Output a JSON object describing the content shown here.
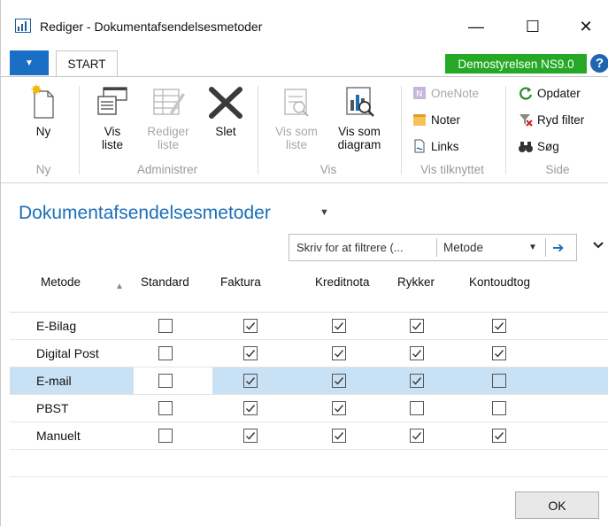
{
  "window": {
    "title": "Rediger - Dokumentafsendelsesmetoder",
    "minimize": "—",
    "maximize": "☐",
    "close": "✕"
  },
  "ribbon_tabs": {
    "active": "START",
    "company": "Demostyrelsen NS9.0",
    "help": "?"
  },
  "ribbon": {
    "new": "Ny",
    "view_list_1": "Vis",
    "view_list_2": "liste",
    "edit_list_1": "Rediger",
    "edit_list_2": "liste",
    "delete": "Slet",
    "view_as_list_1": "Vis som",
    "view_as_list_2": "liste",
    "view_as_chart_1": "Vis som",
    "view_as_chart_2": "diagram",
    "onenote": "OneNote",
    "notes": "Noter",
    "links": "Links",
    "refresh": "Opdater",
    "clear_filter": "Ryd filter",
    "search": "Søg",
    "groups": {
      "new": "Ny",
      "manage": "Administrer",
      "view": "Vis",
      "show_attached": "Vis tilknyttet",
      "page": "Side"
    }
  },
  "page": {
    "title": "Dokumentafsendelsesmetoder",
    "filter_placeholder": "Skriv for at filtrere (...",
    "filter_field": "Metode"
  },
  "columns": [
    "Metode",
    "Standard",
    "Faktura",
    "Kreditnota",
    "Rykker",
    "Kontoudtog"
  ],
  "rows": [
    {
      "name": "E-Bilag",
      "values": [
        false,
        true,
        true,
        true,
        true
      ]
    },
    {
      "name": "Digital Post",
      "values": [
        false,
        true,
        true,
        true,
        true
      ]
    },
    {
      "name": "E-mail",
      "values": [
        false,
        true,
        true,
        true,
        false
      ],
      "selected": true
    },
    {
      "name": "PBST",
      "values": [
        false,
        true,
        true,
        false,
        false
      ]
    },
    {
      "name": "Manuelt",
      "values": [
        false,
        true,
        true,
        true,
        true
      ]
    }
  ],
  "footer": {
    "ok": "OK"
  }
}
